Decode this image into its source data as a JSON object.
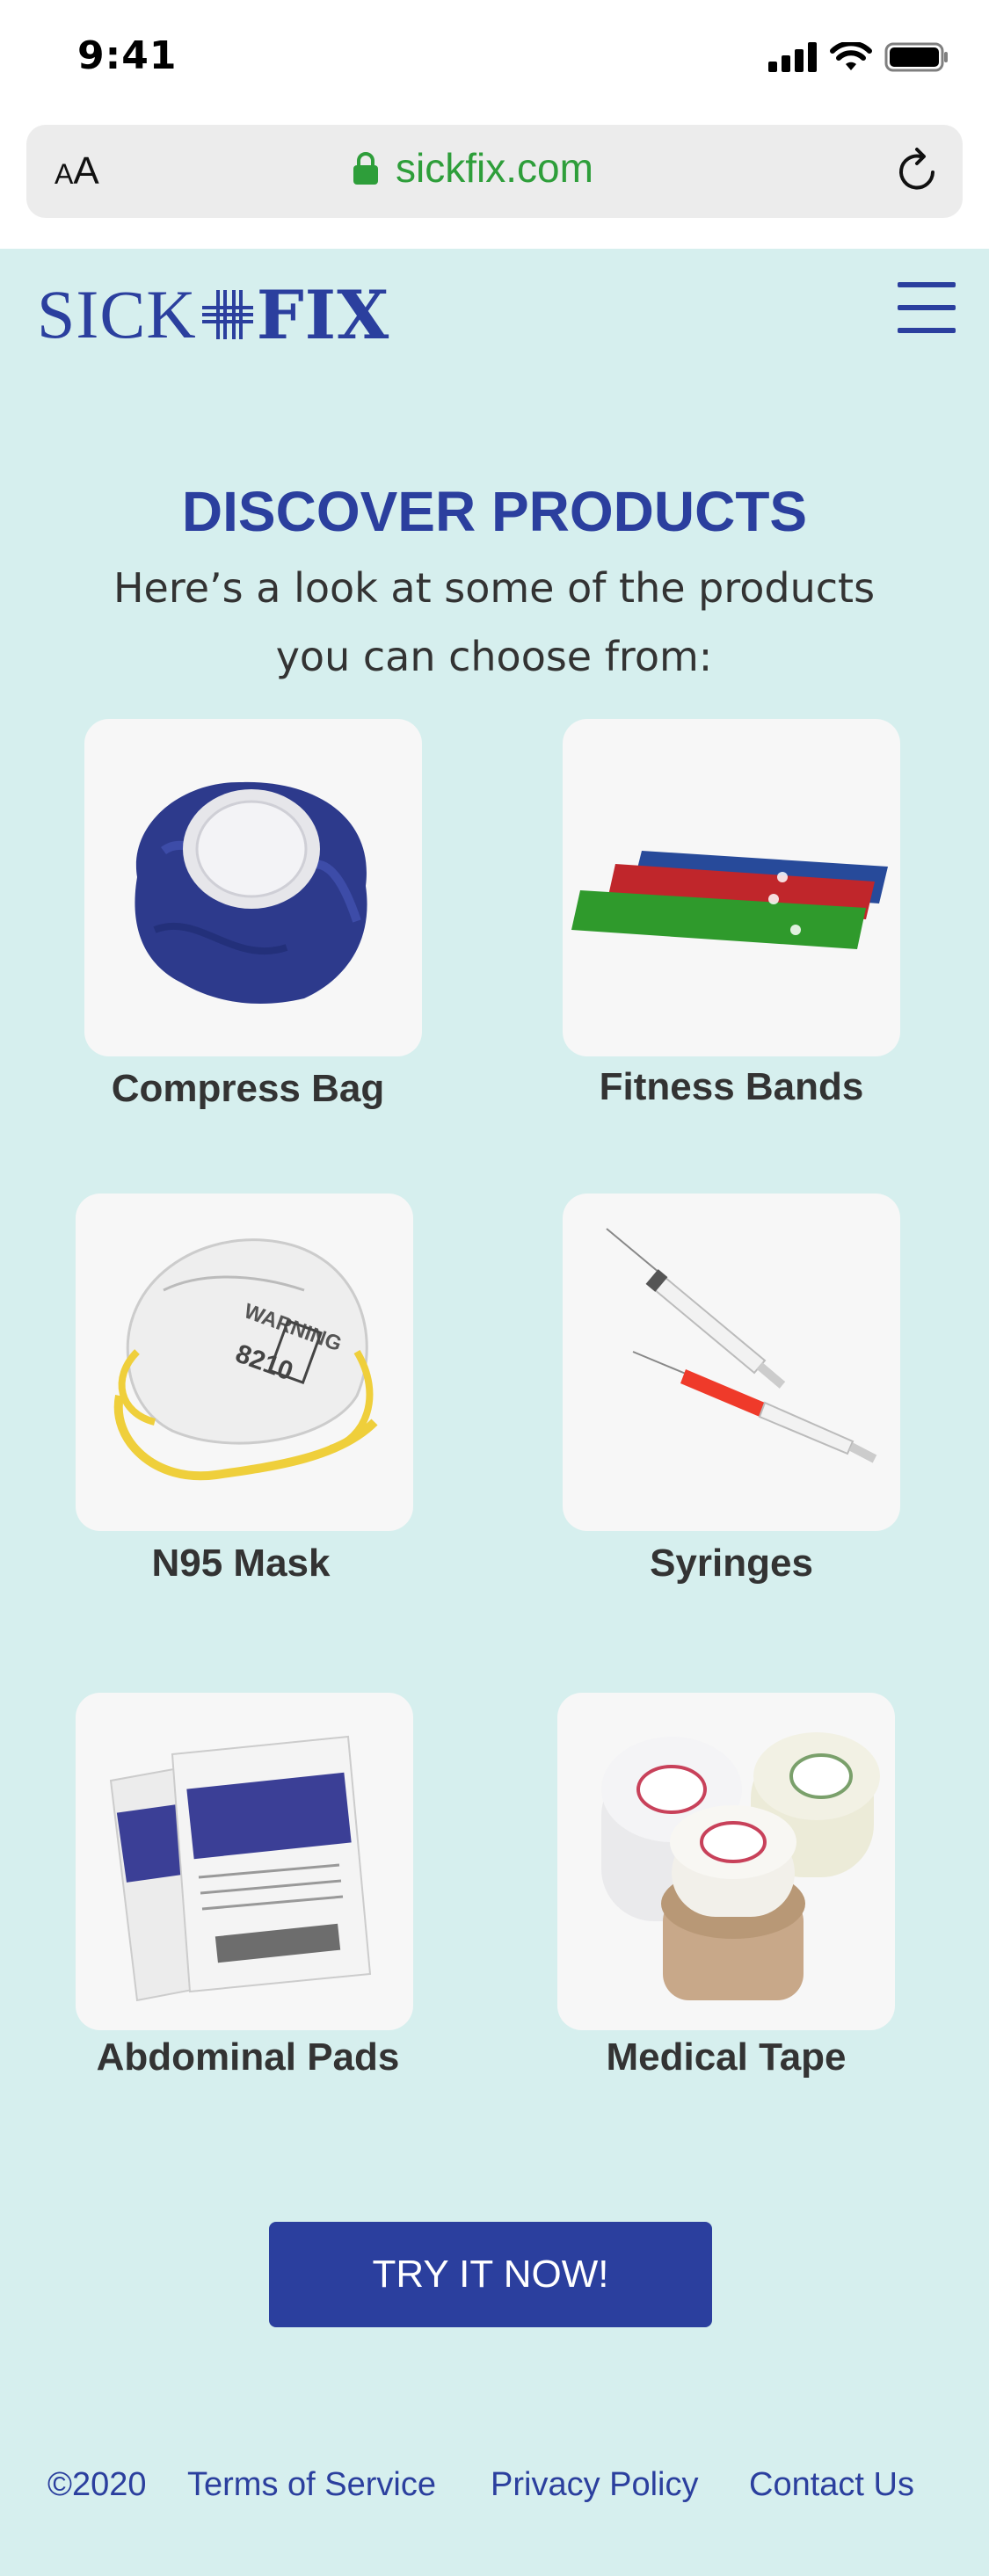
{
  "status_bar": {
    "time": "9:41",
    "icons": [
      "signal-icon",
      "wifi-icon",
      "battery-icon"
    ]
  },
  "browser": {
    "text_size_label_small": "A",
    "text_size_label_big": "A",
    "url": "sickfix.com",
    "url_color": "#2e9e3a",
    "icons": [
      "lock-icon",
      "reload-icon"
    ]
  },
  "header": {
    "logo_left": "SICK",
    "logo_right": "FIX",
    "brand_color": "#2b3f9e",
    "menu_icon": "hamburger-menu-icon"
  },
  "main": {
    "title": "DISCOVER PRODUCTS",
    "intro_line1": "Here’s a look at some of the products",
    "intro_line2": "you can choose from:",
    "products": [
      {
        "name": "Compress Bag",
        "image": "compress-bag-image"
      },
      {
        "name": "Fitness Bands",
        "image": "fitness-bands-image"
      },
      {
        "name": "N95 Mask",
        "image": "n95-mask-image"
      },
      {
        "name": "Syringes",
        "image": "syringes-image"
      },
      {
        "name": "Abdominal Pads",
        "image": "abdominal-pads-image"
      },
      {
        "name": "Medical Tape",
        "image": "medical-tape-image"
      }
    ],
    "cta_label": "TRY IT NOW!"
  },
  "footer": {
    "copyright": "©2020",
    "links": [
      "Terms of Service",
      "Privacy Policy",
      "Contact Us"
    ]
  },
  "background_color": "#d6efee"
}
